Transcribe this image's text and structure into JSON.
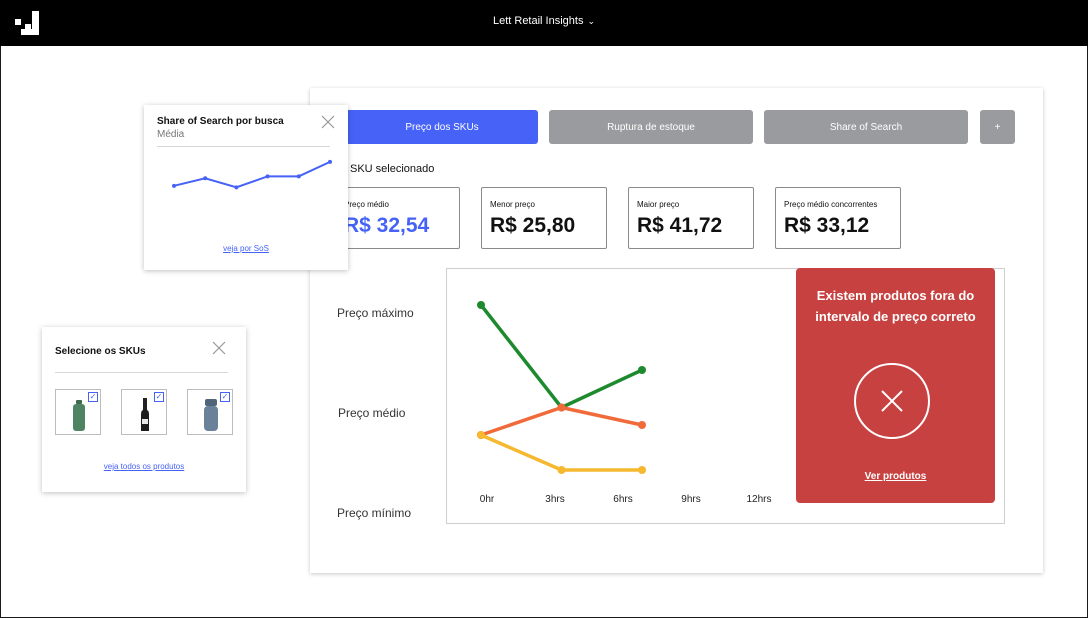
{
  "header": {
    "title": "Lett Retail Insights",
    "dropdown_icon": "chevron-down-icon"
  },
  "tabs": [
    {
      "label": "Preço dos SKUs",
      "active": true
    },
    {
      "label": "Ruptura de estoque",
      "active": false
    },
    {
      "label": "Share of Search",
      "active": false
    },
    {
      "label": "+",
      "active": false
    }
  ],
  "sku_selected_label": "SKU selecionado",
  "stats": [
    {
      "label": "Preço médio",
      "value": "R$ 32,54"
    },
    {
      "label": "Menor preço",
      "value": "R$ 25,80"
    },
    {
      "label": "Maior preço",
      "value": "R$ 41,72"
    },
    {
      "label": "Preço médio concorrentes",
      "value": "R$ 33,12"
    }
  ],
  "chart_data": {
    "type": "line",
    "categories": [
      "0hr",
      "3hrs",
      "6hrs",
      "9hrs",
      "12hrs"
    ],
    "y_categories": [
      "Preço máximo",
      "Preço médio",
      "Preço mínimo"
    ],
    "series": [
      {
        "color": "#1e8a2e",
        "values": [
          0.86,
          0.45,
          0.6
        ]
      },
      {
        "color": "#f06a3a",
        "values": [
          0.34,
          0.45,
          0.38
        ]
      },
      {
        "color": "#f5b82e",
        "values": [
          0.34,
          0.2,
          0.2
        ]
      }
    ]
  },
  "alert": {
    "message": "Existem produtos fora do intervalo de preço correto",
    "link": "Ver produtos",
    "icon": "close-circle-icon",
    "color": "#c84141"
  },
  "share_card": {
    "title": "Share of Search por busca",
    "subtitle": "Média",
    "link": "veja por SoS",
    "sparkline": [
      0.32,
      0.52,
      0.28,
      0.57,
      0.57,
      0.95
    ],
    "color": "#4662f7"
  },
  "sku_card": {
    "title": "Selecione os SKUs",
    "link": "veja todos os produtos",
    "items": [
      {
        "name": "green-bottle-icon",
        "checked": true
      },
      {
        "name": "wine-bottle-icon",
        "checked": true
      },
      {
        "name": "blue-flask-icon",
        "checked": true
      }
    ]
  }
}
